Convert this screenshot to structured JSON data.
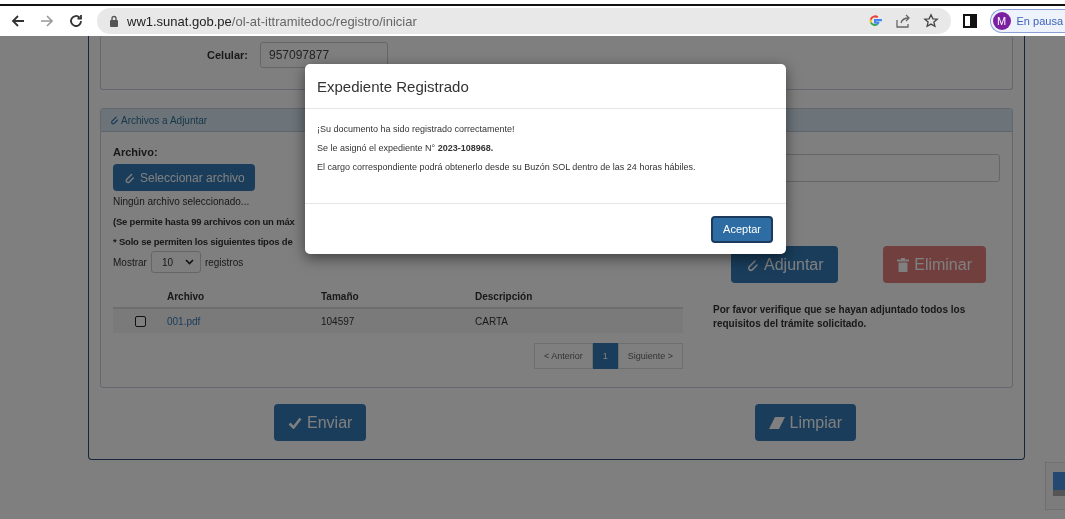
{
  "browser": {
    "url_domain": "ww1.sunat.gob.pe",
    "url_path": "/ol-at-ittramitedoc/registro/iniciar",
    "profile": {
      "initial": "M",
      "status": "En pausa"
    }
  },
  "contact": {
    "label": "Celular:",
    "value": "957097877"
  },
  "attachments": {
    "title": "Archivos a Adjuntar",
    "file_label": "Archivo:",
    "select_button": "Seleccionar archivo",
    "no_file": "Ningún archivo seleccionado...",
    "note_1": "(Se permite hasta 99 archivos con un máx",
    "note_2": "* Solo se permiten los siguientes tipos de",
    "show": {
      "prefix": "Mostrar",
      "value": "10",
      "suffix": "registros"
    },
    "columns": [
      "Archivo",
      "Tamaño",
      "Descripción"
    ],
    "rows": [
      {
        "checked": false,
        "file": "001.pdf",
        "size": "104597",
        "description": "CARTA"
      }
    ],
    "pagination": {
      "previous": "< Anterior",
      "pages": [
        {
          "label": "1",
          "selected": true
        }
      ],
      "next": "Siguiente >"
    },
    "attach_button": "Adjuntar",
    "delete_button": "Eliminar",
    "verify_note": "Por favor verifique que se hayan adjuntado todos los requisitos del trámite solicitado."
  },
  "actions": [
    {
      "kind": "send",
      "label": "Enviar"
    },
    {
      "kind": "clear",
      "label": "Limpiar"
    }
  ],
  "modal": {
    "title": "Expediente Registrado",
    "lines": [
      "¡Su documento ha sido registrado correctamente!",
      "Se le asignó el expediente N° **2023-108968.**",
      "El cargo correspondiente podrá obtenerlo desde su Buzón SOL dentro de las 24 horas hábiles."
    ],
    "button": "Aceptar"
  }
}
